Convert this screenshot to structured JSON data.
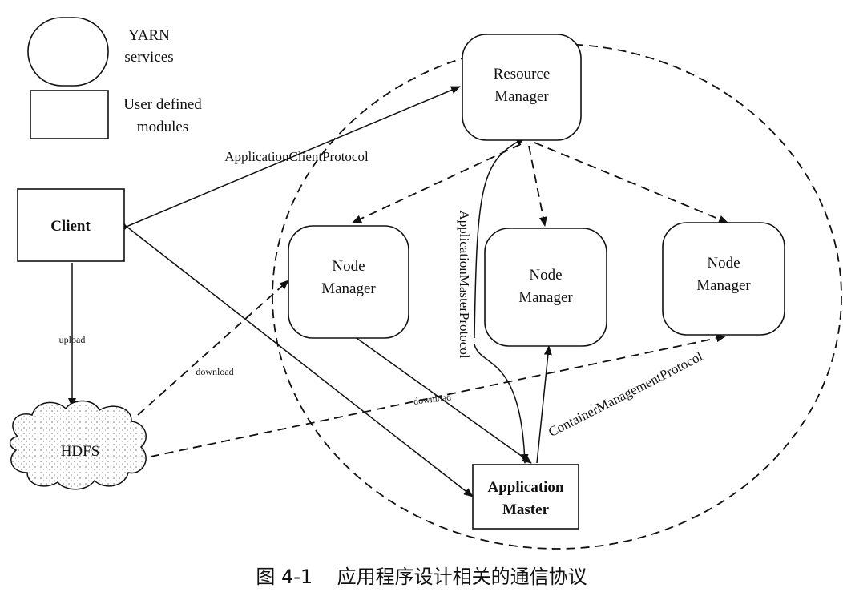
{
  "legend": {
    "yarn_line1": "YARN",
    "yarn_line2": "services",
    "user_line1": "User defined",
    "user_line2": "modules"
  },
  "nodes": {
    "resource_manager": [
      "Resource",
      "Manager"
    ],
    "client": "Client",
    "node_manager_left": [
      "Node",
      "Manager"
    ],
    "node_manager_middle": [
      "Node",
      "Manager"
    ],
    "node_manager_right": [
      "Node",
      "Manager"
    ],
    "hdfs": "HDFS",
    "application_master": [
      "Application",
      "Master"
    ]
  },
  "edges": {
    "application_client_protocol": "ApplicationClientProtocol",
    "application_master_protocol": "ApplicationMasterProtocol",
    "container_management_protocol": "ContainerManagementProtocol",
    "upload": "upload",
    "download_hdfs": "download",
    "download_am": "download"
  },
  "caption": "图 4-1    应用程序设计相关的通信协议"
}
